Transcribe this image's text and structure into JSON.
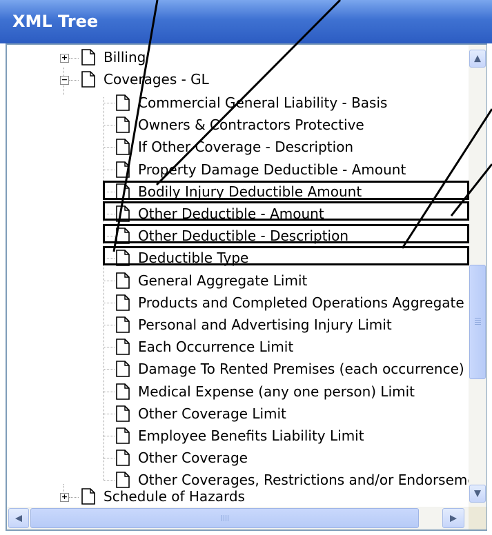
{
  "window": {
    "title": "XML Tree"
  },
  "tree": {
    "parents": [
      {
        "label": "Billing",
        "expander": "+"
      },
      {
        "label": "Coverages - GL",
        "expander": "−"
      }
    ],
    "children": [
      "Commercial General Liability - Basis",
      "Owners & Contractors Protective",
      "If Other Coverage - Description",
      "Property Damage Deductible - Amount",
      "Bodily Injury Deductible Amount",
      "Other Deductible - Amount",
      "Other Deductible - Description",
      "Deductible Type",
      "General Aggregate Limit",
      "Products and Completed Operations Aggregate Li",
      "Personal and Advertising Injury Limit",
      "Each Occurrence Limit",
      "Damage To Rented Premises (each occurrence) Li",
      "Medical Expense (any one person) Limit",
      "Other Coverage Limit",
      "Employee Benefits Liability Limit",
      "Other Coverage",
      "Other Coverages, Restrictions and/or Endorseme"
    ],
    "trailing": {
      "label": "Schedule of Hazards",
      "expander": "+"
    },
    "highlighted": [
      "Bodily Injury Deductible Amount",
      "Other Deductible - Amount",
      "Other Deductible - Description",
      "Deductible Type"
    ]
  },
  "scrollbars": {
    "up_arrow": "▲",
    "down_arrow": "▼",
    "left_arrow": "◀",
    "right_arrow": "▶"
  },
  "colors": {
    "titlebar": "#3f72d2",
    "title_text": "#ffffff",
    "highlight_box": "#000000"
  }
}
